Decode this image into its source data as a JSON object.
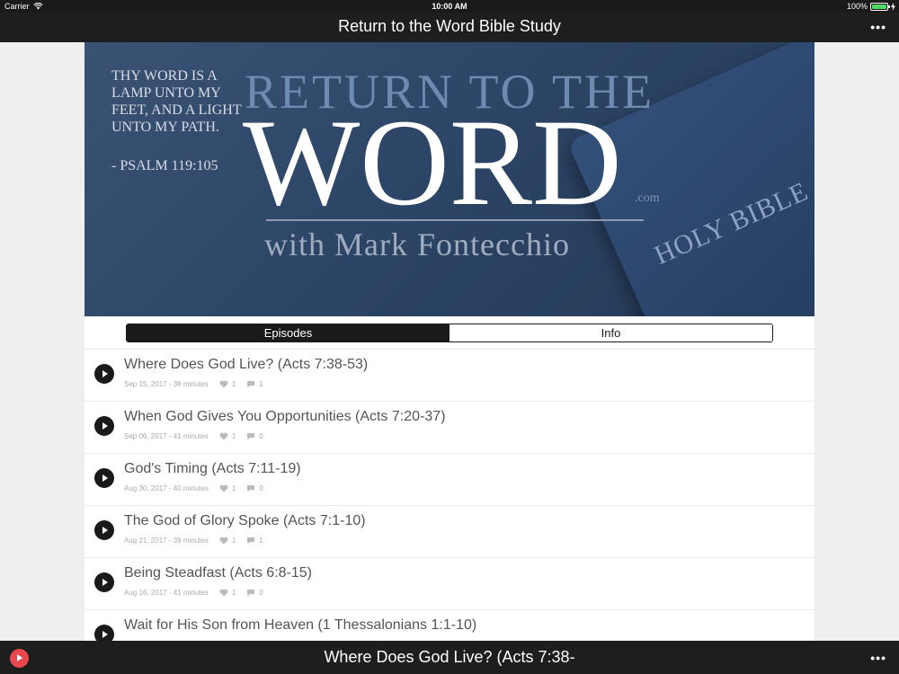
{
  "status_bar": {
    "carrier": "Carrier",
    "time": "10:00 AM",
    "battery": "100%"
  },
  "header": {
    "title": "Return to the Word Bible Study",
    "more_icon": "more-horizontal-icon"
  },
  "banner": {
    "verse": "THY WORD IS A LAMP UNTO MY FEET, AND A LIGHT UNTO MY PATH.",
    "verse_ref": "- PSALM 119:105",
    "line1": "RETURN TO THE",
    "line2": "WORD",
    "dotcom": ".com",
    "byline": "with Mark Fontecchio",
    "bible_label": "HOLY BIBLE"
  },
  "tabs": [
    {
      "label": "Episodes",
      "active": true
    },
    {
      "label": "Info",
      "active": false
    }
  ],
  "episodes": [
    {
      "title": "Where Does God Live? (Acts 7:38-53)",
      "meta": "Sep 15, 2017 - 38 minutes",
      "likes": "1",
      "comments": "1"
    },
    {
      "title": "When God Gives You Opportunities (Acts 7:20-37)",
      "meta": "Sep 06, 2017 - 41 minutes",
      "likes": "1",
      "comments": "0"
    },
    {
      "title": "God's Timing (Acts 7:11-19)",
      "meta": "Aug 30, 2017 - 40 minutes",
      "likes": "1",
      "comments": "0"
    },
    {
      "title": "The God of Glory Spoke (Acts 7:1-10)",
      "meta": "Aug 21, 2017 - 39 minutes",
      "likes": "1",
      "comments": "1"
    },
    {
      "title": "Being Steadfast (Acts 6:8-15)",
      "meta": "Aug 16, 2017 - 41 minutes",
      "likes": "1",
      "comments": "0"
    },
    {
      "title": "Wait for His Son from Heaven (1 Thessalonians 1:1-10)",
      "meta": "",
      "likes": "",
      "comments": ""
    }
  ],
  "mini_player": {
    "now_playing": "Where Does God Live? (Acts 7:38-"
  },
  "colors": {
    "bar_background": "#1e1e1e",
    "mini_play_accent": "#e8474c",
    "battery_green": "#4cd964"
  }
}
